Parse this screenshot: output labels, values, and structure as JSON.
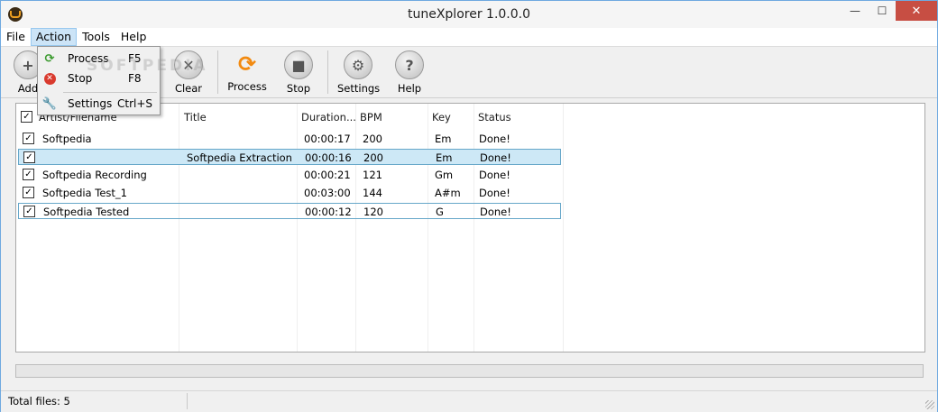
{
  "window": {
    "title": "tuneXplorer 1.0.0.0",
    "minimize": "—",
    "maximize": "☐",
    "close": "✕"
  },
  "menubar": [
    "File",
    "Action",
    "Tools",
    "Help"
  ],
  "toolbar": {
    "add": "Add",
    "clear": "Clear",
    "process": "Process",
    "stop": "Stop",
    "settings": "Settings",
    "help": "Help"
  },
  "action_menu": [
    {
      "label": "Process",
      "shortcut": "F5",
      "icon": "refresh-icon"
    },
    {
      "label": "Stop",
      "shortcut": "F8",
      "icon": "stop-icon"
    },
    {
      "label": "Settings",
      "shortcut": "Ctrl+S",
      "icon": "wrench-icon"
    }
  ],
  "table": {
    "columns": [
      "Artist/Filename",
      "Title",
      "Duration...",
      "BPM",
      "Key",
      "Status"
    ],
    "rows": [
      [
        "Softpedia",
        "",
        "00:00:17",
        "200",
        "Em",
        "Done!"
      ],
      [
        "",
        "Softpedia Extraction",
        "00:00:16",
        "200",
        "Em",
        "Done!"
      ],
      [
        "Softpedia Recording",
        "",
        "00:00:21",
        "121",
        "Gm",
        "Done!"
      ],
      [
        "Softpedia Test_1",
        "",
        "00:03:00",
        "144",
        "A#m",
        "Done!"
      ],
      [
        "Softpedia Tested",
        "",
        "00:00:12",
        "120",
        "G",
        "Done!"
      ]
    ]
  },
  "statusbar": {
    "total": "Total files: 5"
  },
  "watermark": "SOFTPEDIA",
  "colors": {
    "accent": "#cce4f7",
    "selection": "#cde8f6",
    "close": "#c74e43",
    "process_icon": "#f28a10"
  }
}
